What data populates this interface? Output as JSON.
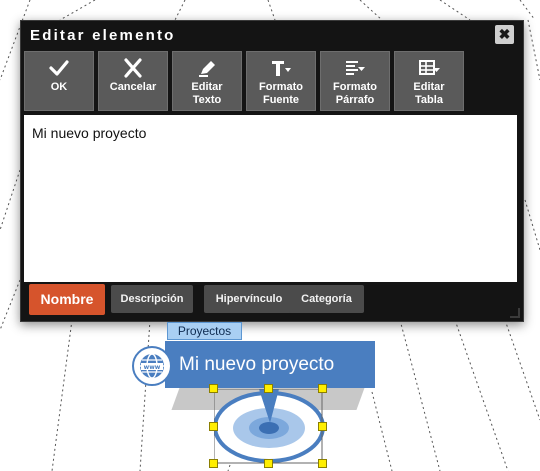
{
  "dialog": {
    "title": "Editar elemento",
    "close_symbol": "✖",
    "toolbar": [
      {
        "name": "ok",
        "label": "OK",
        "icon": "check-icon"
      },
      {
        "name": "cancelar",
        "label": "Cancelar",
        "icon": "close-x-icon"
      },
      {
        "name": "editar-texto",
        "label": "Editar\nTexto",
        "icon": "pencil-icon"
      },
      {
        "name": "formato-fuente",
        "label": "Formato\nFuente",
        "icon": "text-format-icon"
      },
      {
        "name": "formato-parrafo",
        "label": "Formato\nPárrafo",
        "icon": "paragraph-format-icon"
      },
      {
        "name": "editar-tabla",
        "label": "Editar\nTabla",
        "icon": "table-icon"
      }
    ],
    "editor_text": "Mi nuevo proyecto",
    "tabs": [
      {
        "label": "Nombre",
        "active": true
      },
      {
        "label": "Descripción",
        "active": false
      },
      {
        "label": "Hipervínculo",
        "active": false
      },
      {
        "label": "Categoría",
        "active": false
      }
    ]
  },
  "node": {
    "category": "Proyectos",
    "title": "Mi nuevo proyecto"
  },
  "colors": {
    "dialog_bg": "#141414",
    "button_bg": "#5a5a5a",
    "active_tab": "#d6542c",
    "node_blue": "#4a7ec0",
    "category_bg": "#a9cff3",
    "handle_yellow": "#ffee00"
  }
}
